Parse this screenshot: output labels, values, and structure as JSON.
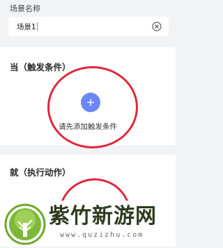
{
  "scene_name": {
    "label": "场景名称",
    "value": "场景1"
  },
  "trigger_section": {
    "title": "当（触发条件）",
    "add_hint": "请先添加触发条件",
    "add_icon": "plus-icon"
  },
  "action_section": {
    "title": "就（执行动作）"
  },
  "watermark": {
    "title": "紫竹新游网",
    "url": "www.quzizhu.com"
  },
  "colors": {
    "accent": "#6b86f5",
    "highlight": "#e0283c",
    "caret": "#33c3a6",
    "background": "#f2f3f5"
  }
}
